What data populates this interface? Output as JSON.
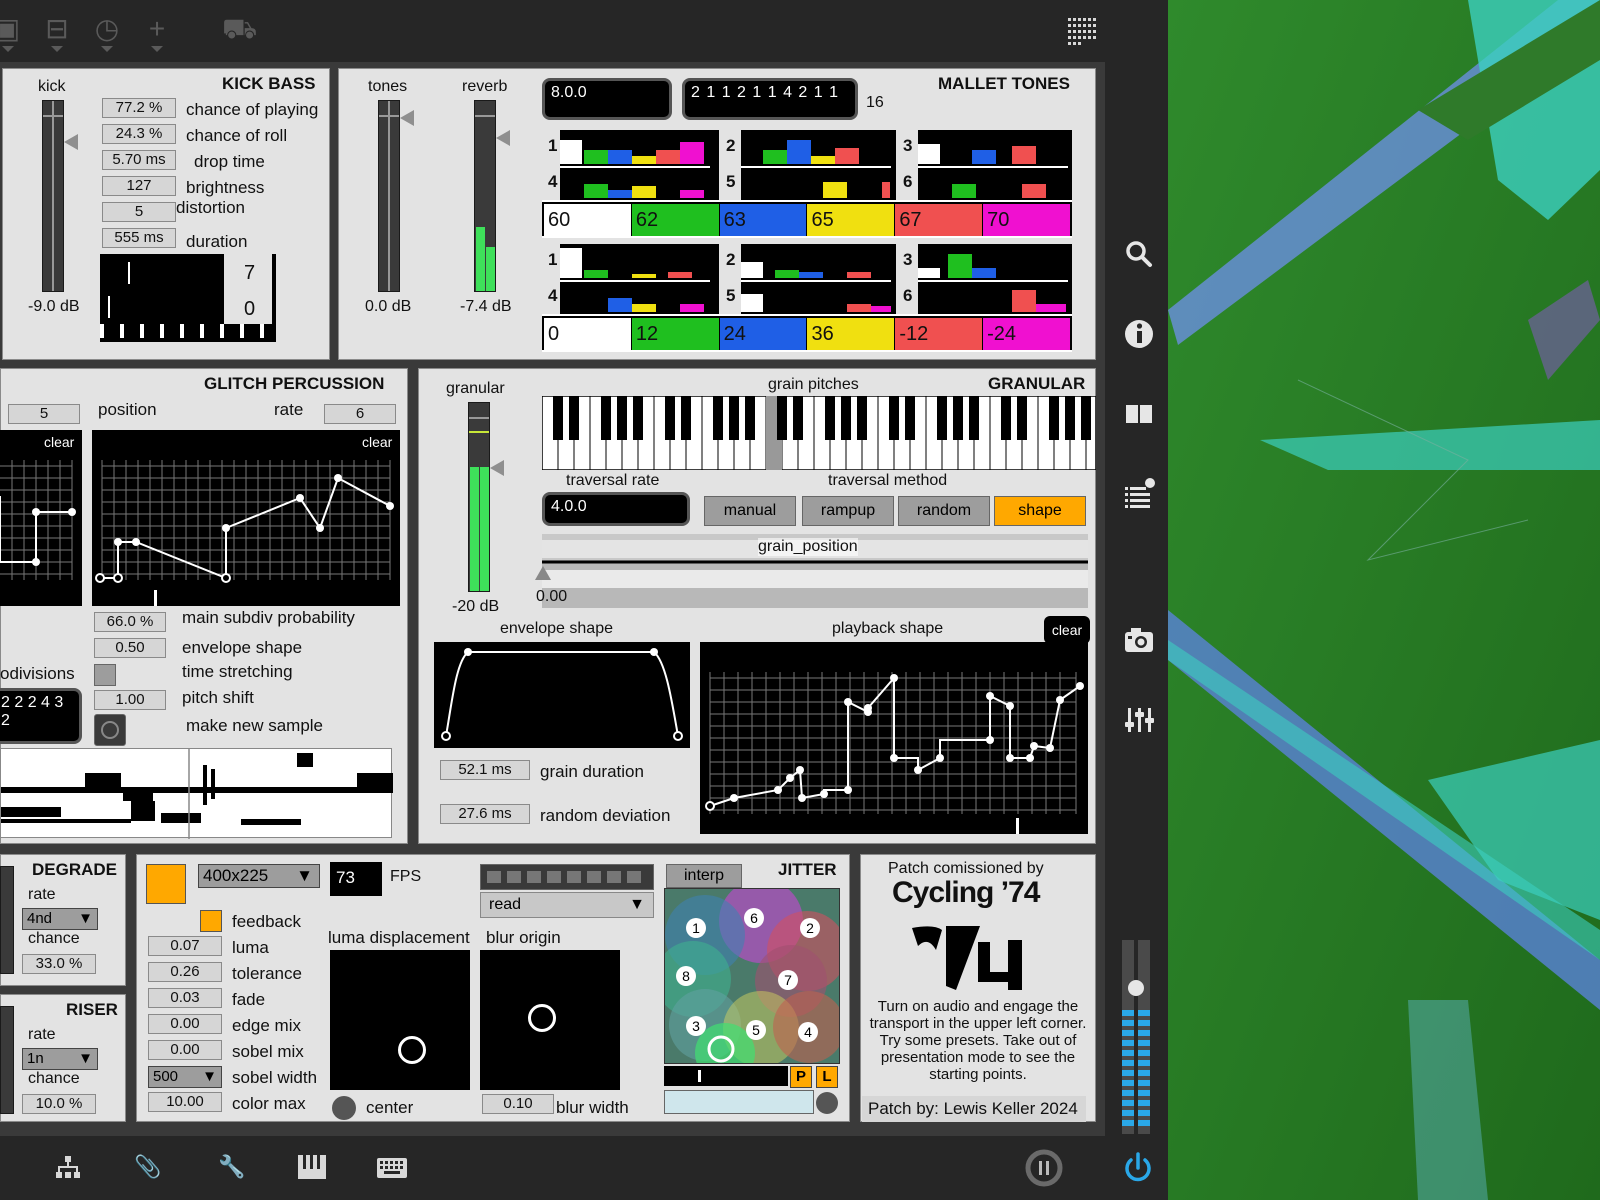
{
  "kick_bass": {
    "title": "KICK BASS",
    "meter_label": "kick",
    "meter_db": "-9.0 dB",
    "params": [
      {
        "value": "77.2 %",
        "label": "chance of playing"
      },
      {
        "value": "24.3 %",
        "label": "chance of roll"
      },
      {
        "value": "5.70 ms",
        "label": "drop time"
      },
      {
        "value": "127",
        "label": "brightness"
      },
      {
        "value": "5",
        "label": "distortion"
      },
      {
        "value": "555 ms",
        "label": "duration"
      }
    ],
    "seq_top": "7",
    "seq_bottom": "0"
  },
  "mallet": {
    "title": "MALLET TONES",
    "tones_label": "tones",
    "reverb_label": "reverb",
    "tones_db": "0.0 dB",
    "reverb_db": "-7.4 dB",
    "tempo": "8.0.0",
    "pattern": "2 1 1 2 1 1 4 2 1 1",
    "pattern_count": "16",
    "slot_labels": [
      "1",
      "2",
      "3",
      "4",
      "5",
      "6"
    ],
    "notes": [
      "60",
      "62",
      "63",
      "65",
      "67",
      "70"
    ],
    "offsets": [
      "0",
      "12",
      "24",
      "36",
      "-12",
      "-24"
    ],
    "colors": [
      "#ffffff",
      "#1fbf1f",
      "#1f5fe6",
      "#f0e010",
      "#f05050",
      "#f010d0"
    ]
  },
  "glitch": {
    "title": "GLITCH PERCUSSION",
    "left_val": "5",
    "position_label": "position",
    "rate_label": "rate",
    "rate_val": "6",
    "clear": "clear",
    "params": [
      {
        "value": "66.0 %",
        "label": "main subdiv probability"
      },
      {
        "value": "0.50",
        "label": "envelope shape"
      },
      {
        "value": "",
        "label": "time stretching"
      },
      {
        "value": "1.00",
        "label": "pitch shift"
      }
    ],
    "make_new": "make new sample",
    "subdivisions_label": "odivisions",
    "subdivisions_line1": "2 2 2 4 3",
    "subdivisions_line2": "2"
  },
  "granular": {
    "title": "GRANULAR",
    "meter_label": "granular",
    "meter_db": "-20 dB",
    "grain_pitches": "grain pitches",
    "traversal_rate_label": "traversal rate",
    "traversal_rate": "4.0.0",
    "traversal_method_label": "traversal method",
    "methods": [
      "manual",
      "rampup",
      "random",
      "shape"
    ],
    "active_method": "shape",
    "grain_position_label": "grain_position",
    "grain_position_val": "0.00",
    "envelope_label": "envelope shape",
    "playback_label": "playback shape",
    "clear": "clear",
    "grain_duration": "52.1 ms",
    "grain_duration_label": "grain duration",
    "random_deviation": "27.6 ms",
    "random_deviation_label": "random deviation"
  },
  "degrade": {
    "title": "DEGRADE",
    "rate_label": "rate",
    "rate_val": "4nd",
    "chance_label": "chance",
    "chance_val": "33.0 %"
  },
  "riser": {
    "title": "RISER",
    "rate_label": "rate",
    "rate_val": "1n",
    "chance_label": "chance",
    "chance_val": "10.0 %"
  },
  "video": {
    "resolution": "400x225",
    "fps": "73",
    "fps_label": "FPS",
    "feedback_label": "feedback",
    "params": [
      {
        "value": "0.07",
        "label": "luma"
      },
      {
        "value": "0.26",
        "label": "tolerance"
      },
      {
        "value": "0.03",
        "label": "fade"
      },
      {
        "value": "0.00",
        "label": "edge mix"
      },
      {
        "value": "0.00",
        "label": "sobel mix"
      },
      {
        "value": "500",
        "label": "sobel width"
      },
      {
        "value": "10.00",
        "label": "color max"
      }
    ],
    "luma_disp_label": "luma displacement",
    "blur_origin_label": "blur origin",
    "center_label": "center",
    "blur_width": "0.10",
    "blur_width_label": "blur width",
    "read_label": "read",
    "interp": "interp",
    "jitter": "JITTER",
    "preset_numbers": [
      "1",
      "6",
      "2",
      "8",
      "7",
      "3",
      "5",
      "4"
    ],
    "p": "P",
    "l": "L"
  },
  "credits": {
    "line1": "Patch comissioned by",
    "brand": "Cycling ’74",
    "instructions": "Turn on audio and engage the transport in the upper left corner. Try some presets. Take out of presentation mode to see the starting points.",
    "author": "Patch by: Lewis Keller 2024"
  },
  "icons": {
    "search": "search-icon",
    "info": "info-icon",
    "book": "book-icon",
    "list": "list-icon",
    "camera": "camera-icon",
    "mixer": "mixer-icon"
  }
}
